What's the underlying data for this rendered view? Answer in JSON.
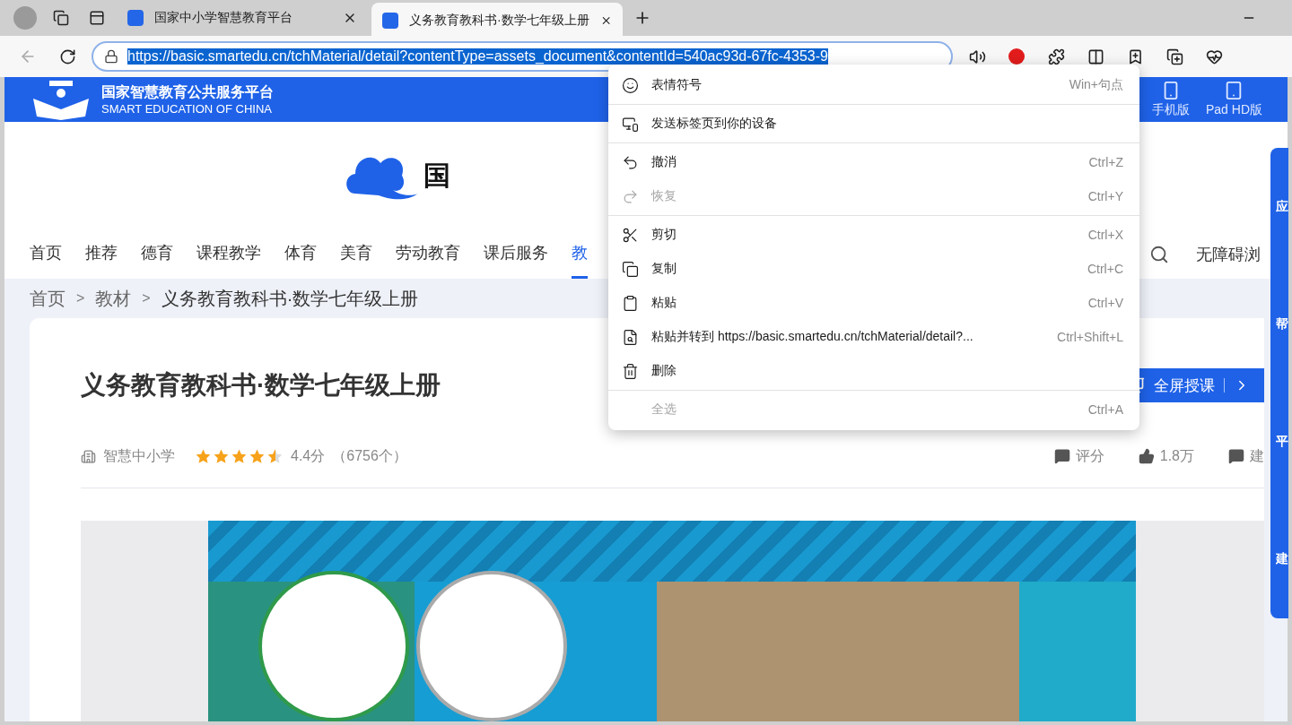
{
  "browser": {
    "tabs": [
      {
        "title": "国家中小学智慧教育平台",
        "selected": false
      },
      {
        "title": "义务教育教科书·数学七年级上册",
        "selected": true
      }
    ],
    "address": "https://basic.smartedu.cn/tchMaterial/detail?contentType=assets_document&contentId=540ac93d-67fc-4353-9"
  },
  "site_header": {
    "title": "国家智慧教育公共服务平台",
    "subtitle": "SMART EDUCATION OF CHINA",
    "links": [
      {
        "kind": "phone",
        "label": "手机版"
      },
      {
        "kind": "tablet",
        "label": "Pad HD版"
      }
    ]
  },
  "brand": {
    "text": "国"
  },
  "nav": {
    "items": [
      {
        "label": "首页",
        "selected": false
      },
      {
        "label": "推荐",
        "selected": false
      },
      {
        "label": "德育",
        "selected": false
      },
      {
        "label": "课程教学",
        "selected": false
      },
      {
        "label": "体育",
        "selected": false
      },
      {
        "label": "美育",
        "selected": false
      },
      {
        "label": "劳动教育",
        "selected": false
      },
      {
        "label": "课后服务",
        "selected": false
      },
      {
        "label": "教",
        "selected": true
      }
    ],
    "accessibility": "无障碍浏"
  },
  "breadcrumb": {
    "items": [
      "首页",
      "教材",
      "义务教育教科书·数学七年级上册"
    ],
    "separators": [
      ">",
      ">"
    ]
  },
  "resource": {
    "title": "义务教育教科书·数学七年级上册",
    "publisher": "智慧中小学",
    "stars": 4.5,
    "score": "4.4分",
    "count": "（6756个）",
    "actions": [
      {
        "kind": "rate",
        "label": "评分"
      },
      {
        "kind": "like",
        "label": "1.8万"
      },
      {
        "kind": "suggest",
        "label": "建"
      }
    ],
    "present_button": "全屏授课"
  },
  "side_panel": {
    "items": [
      "应",
      "帮",
      "平",
      "建"
    ]
  },
  "context_menu": {
    "groups": [
      [
        {
          "kind": "emoji",
          "label": "表情符号",
          "shortcut": "Win+句点",
          "disabled": false
        }
      ],
      [
        {
          "kind": "send",
          "label": "发送标签页到你的设备",
          "disabled": false
        }
      ],
      [
        {
          "kind": "undo",
          "label": "撤消",
          "shortcut": "Ctrl+Z",
          "disabled": false
        },
        {
          "kind": "redo",
          "label": "恢复",
          "shortcut": "Ctrl+Y",
          "disabled": true
        }
      ],
      [
        {
          "kind": "cut",
          "label": "剪切",
          "shortcut": "Ctrl+X",
          "disabled": false
        },
        {
          "kind": "copy",
          "label": "复制",
          "shortcut": "Ctrl+C",
          "disabled": false
        },
        {
          "kind": "paste",
          "label": "粘贴",
          "shortcut": "Ctrl+V",
          "disabled": false
        },
        {
          "kind": "paste_go",
          "label": "粘贴并转到 https://basic.smartedu.cn/tchMaterial/detail?...",
          "shortcut": "Ctrl+Shift+L",
          "disabled": false
        },
        {
          "kind": "delete",
          "label": "删除",
          "disabled": false
        }
      ],
      [
        {
          "kind": "select_all",
          "label": "全选",
          "shortcut": "Ctrl+A",
          "disabled": true
        }
      ]
    ]
  }
}
